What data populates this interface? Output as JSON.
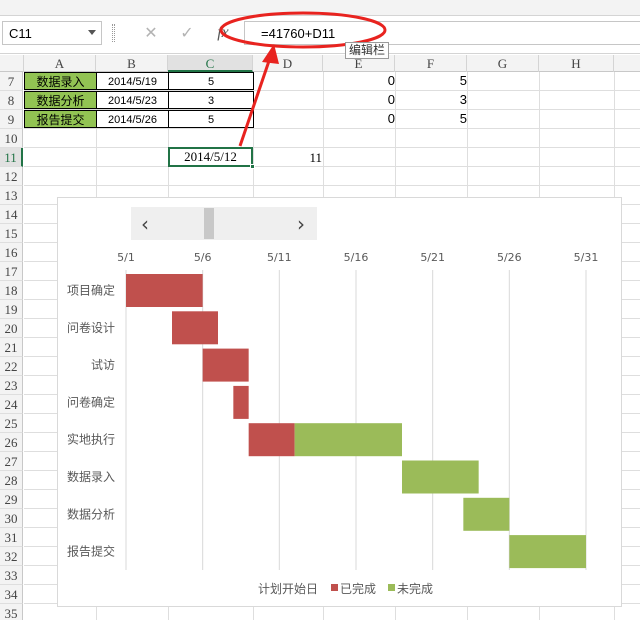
{
  "formula_bar": {
    "name_box": "C11",
    "cancel_icon": "✕",
    "confirm_icon": "✓",
    "fx_label": "fx",
    "formula": "=41760+D11",
    "tooltip": "编辑栏"
  },
  "columns": [
    "A",
    "B",
    "C",
    "D",
    "E",
    "F",
    "G",
    "H"
  ],
  "active_column": "C",
  "rows": [
    "7",
    "8",
    "9",
    "10",
    "11",
    "12",
    "13",
    "14",
    "15",
    "16",
    "17",
    "18",
    "19",
    "20",
    "21",
    "22",
    "23",
    "24",
    "25",
    "26",
    "27",
    "28",
    "29",
    "30",
    "31",
    "32",
    "33",
    "34",
    "35"
  ],
  "active_row": "11",
  "table_rows": [
    {
      "task": "数据录入",
      "date": "2014/5/19",
      "days": "5",
      "done": "0",
      "remaining": "5"
    },
    {
      "task": "数据分析",
      "date": "2014/5/23",
      "days": "3",
      "done": "0",
      "remaining": "3"
    },
    {
      "task": "报告提交",
      "date": "2014/5/26",
      "days": "5",
      "done": "0",
      "remaining": "5"
    }
  ],
  "cell_c11": "2014/5/12",
  "cell_d11": "11",
  "chart_data": {
    "type": "bar",
    "orientation": "horizontal-stacked-gantt",
    "categories": [
      "项目确定",
      "问卷设计",
      "试访",
      "问卷确定",
      "实地执行",
      "数据录入",
      "数据分析",
      "报告提交"
    ],
    "x_ticks": [
      "5/1",
      "5/6",
      "5/11",
      "5/16",
      "5/21",
      "5/26",
      "5/31"
    ],
    "xlim": [
      "2014/5/1",
      "2014/5/31"
    ],
    "series": [
      {
        "name": "计划开始日",
        "color": "none",
        "values": [
          "2014/5/1",
          "2014/5/4",
          "2014/5/6",
          "2014/5/8",
          "2014/5/9",
          "2014/5/19",
          "2014/5/23",
          "2014/5/26"
        ]
      },
      {
        "name": "已完成",
        "color": "#c0504d",
        "values": [
          5,
          3,
          3,
          1,
          3,
          0,
          0,
          0
        ]
      },
      {
        "name": "未完成",
        "color": "#9bbb59",
        "values": [
          0,
          0,
          0,
          0,
          7,
          5,
          3,
          5
        ]
      }
    ],
    "legend": [
      "计划开始日",
      "已完成",
      "未完成"
    ],
    "legend_position": "bottom",
    "gridlines": true
  },
  "annotation_color": "#e8231f"
}
